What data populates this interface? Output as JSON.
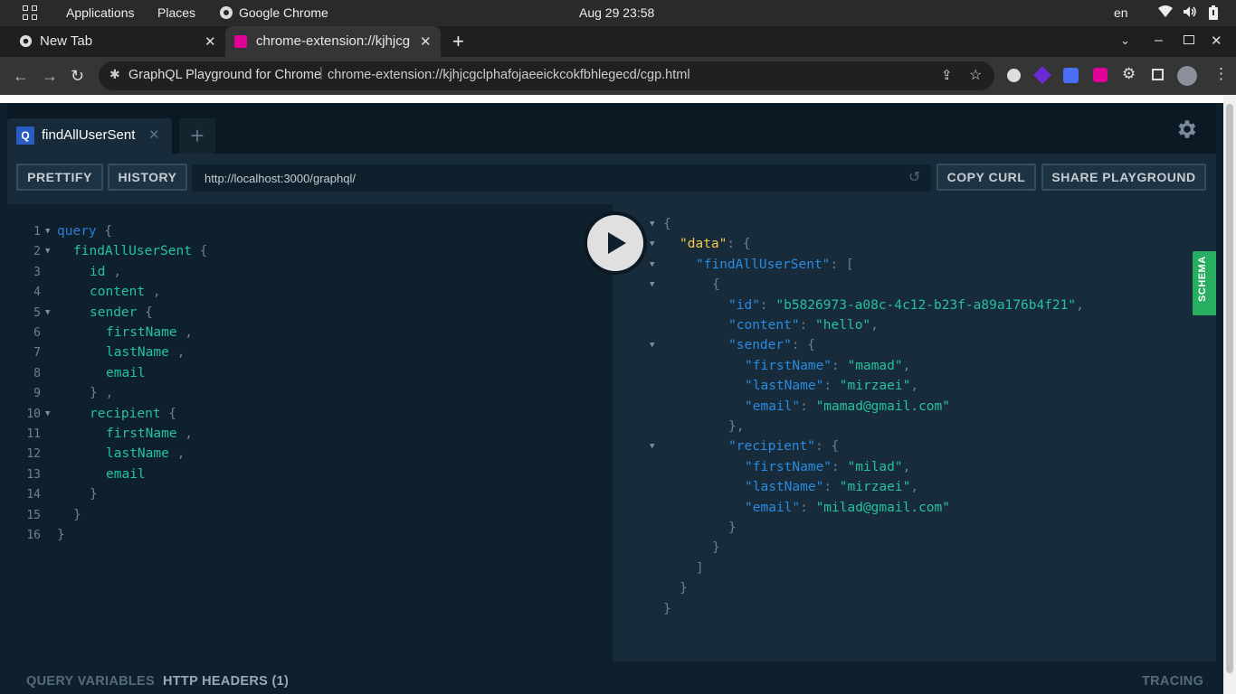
{
  "system": {
    "applications": "Applications",
    "places": "Places",
    "active_app": "Google Chrome",
    "clock": "Aug 29  23:58",
    "lang": "en"
  },
  "browser": {
    "tabs": [
      {
        "title": "New Tab"
      },
      {
        "title": "chrome-extension://kjhjcg"
      }
    ],
    "page_title": "GraphQL Playground for Chrome",
    "url": "chrome-extension://kjhjcgclphafojaeeickcokfbhlegecd/cgp.html"
  },
  "playground": {
    "tab": {
      "badge": "Q",
      "name": "findAllUserSent"
    },
    "buttons": {
      "prettify": "PRETTIFY",
      "history": "HISTORY",
      "copy_curl": "COPY CURL",
      "share": "SHARE PLAYGROUND"
    },
    "endpoint": "http://localhost:3000/graphql/",
    "schema_tab": "SCHEMA",
    "footer": {
      "query_variables": "QUERY VARIABLES",
      "http_headers": "HTTP HEADERS (1)",
      "tracing": "TRACING"
    },
    "query_lines": [
      {
        "n": "1",
        "indent": 0,
        "fold": true,
        "tokens": [
          {
            "t": "query",
            "c": "kw"
          },
          {
            "t": " {",
            "c": "punc"
          }
        ]
      },
      {
        "n": "2",
        "indent": 1,
        "fold": true,
        "tokens": [
          {
            "t": "findAllUserSent",
            "c": "field"
          },
          {
            "t": " {",
            "c": "punc"
          }
        ]
      },
      {
        "n": "3",
        "indent": 2,
        "fold": false,
        "tokens": [
          {
            "t": "id",
            "c": "field"
          },
          {
            "t": " ,",
            "c": "punc"
          }
        ]
      },
      {
        "n": "4",
        "indent": 2,
        "fold": false,
        "tokens": [
          {
            "t": "content",
            "c": "field"
          },
          {
            "t": " ,",
            "c": "punc"
          }
        ]
      },
      {
        "n": "5",
        "indent": 2,
        "fold": true,
        "tokens": [
          {
            "t": "sender",
            "c": "field"
          },
          {
            "t": " {",
            "c": "punc"
          }
        ]
      },
      {
        "n": "6",
        "indent": 3,
        "fold": false,
        "tokens": [
          {
            "t": "firstName",
            "c": "field"
          },
          {
            "t": " ,",
            "c": "punc"
          }
        ]
      },
      {
        "n": "7",
        "indent": 3,
        "fold": false,
        "tokens": [
          {
            "t": "lastName",
            "c": "field"
          },
          {
            "t": " ,",
            "c": "punc"
          }
        ]
      },
      {
        "n": "8",
        "indent": 3,
        "fold": false,
        "tokens": [
          {
            "t": "email",
            "c": "field"
          }
        ]
      },
      {
        "n": "9",
        "indent": 2,
        "fold": false,
        "tokens": [
          {
            "t": "} ,",
            "c": "punc"
          }
        ]
      },
      {
        "n": "10",
        "indent": 2,
        "fold": true,
        "tokens": [
          {
            "t": "recipient",
            "c": "field"
          },
          {
            "t": " {",
            "c": "punc"
          }
        ]
      },
      {
        "n": "11",
        "indent": 3,
        "fold": false,
        "tokens": [
          {
            "t": "firstName",
            "c": "field"
          },
          {
            "t": " ,",
            "c": "punc"
          }
        ]
      },
      {
        "n": "12",
        "indent": 3,
        "fold": false,
        "tokens": [
          {
            "t": "lastName",
            "c": "field"
          },
          {
            "t": " ,",
            "c": "punc"
          }
        ]
      },
      {
        "n": "13",
        "indent": 3,
        "fold": false,
        "tokens": [
          {
            "t": "email",
            "c": "field"
          }
        ]
      },
      {
        "n": "14",
        "indent": 2,
        "fold": false,
        "tokens": [
          {
            "t": "}",
            "c": "punc"
          }
        ]
      },
      {
        "n": "15",
        "indent": 1,
        "fold": false,
        "tokens": [
          {
            "t": "}",
            "c": "punc"
          }
        ]
      },
      {
        "n": "16",
        "indent": 0,
        "fold": false,
        "tokens": [
          {
            "t": "}",
            "c": "punc"
          }
        ]
      }
    ],
    "result_lines": [
      {
        "indent": 0,
        "fold": true,
        "tokens": [
          {
            "t": "{",
            "c": "punc"
          }
        ]
      },
      {
        "indent": 1,
        "fold": true,
        "tokens": [
          {
            "t": "\"data\"",
            "c": "datakey"
          },
          {
            "t": ": {",
            "c": "punc"
          }
        ]
      },
      {
        "indent": 2,
        "fold": true,
        "tokens": [
          {
            "t": "\"findAllUserSent\"",
            "c": "key"
          },
          {
            "t": ": [",
            "c": "punc"
          }
        ]
      },
      {
        "indent": 3,
        "fold": true,
        "tokens": [
          {
            "t": "{",
            "c": "punc"
          }
        ]
      },
      {
        "indent": 4,
        "fold": false,
        "tokens": [
          {
            "t": "\"id\"",
            "c": "key"
          },
          {
            "t": ": ",
            "c": "punc"
          },
          {
            "t": "\"b5826973-a08c-4c12-b23f-a89a176b4f21\"",
            "c": "str"
          },
          {
            "t": ",",
            "c": "punc"
          }
        ]
      },
      {
        "indent": 4,
        "fold": false,
        "tokens": [
          {
            "t": "\"content\"",
            "c": "key"
          },
          {
            "t": ": ",
            "c": "punc"
          },
          {
            "t": "\"hello\"",
            "c": "str"
          },
          {
            "t": ",",
            "c": "punc"
          }
        ]
      },
      {
        "indent": 4,
        "fold": true,
        "tokens": [
          {
            "t": "\"sender\"",
            "c": "key"
          },
          {
            "t": ": {",
            "c": "punc"
          }
        ]
      },
      {
        "indent": 5,
        "fold": false,
        "tokens": [
          {
            "t": "\"firstName\"",
            "c": "key"
          },
          {
            "t": ": ",
            "c": "punc"
          },
          {
            "t": "\"mamad\"",
            "c": "str"
          },
          {
            "t": ",",
            "c": "punc"
          }
        ]
      },
      {
        "indent": 5,
        "fold": false,
        "tokens": [
          {
            "t": "\"lastName\"",
            "c": "key"
          },
          {
            "t": ": ",
            "c": "punc"
          },
          {
            "t": "\"mirzaei\"",
            "c": "str"
          },
          {
            "t": ",",
            "c": "punc"
          }
        ]
      },
      {
        "indent": 5,
        "fold": false,
        "tokens": [
          {
            "t": "\"email\"",
            "c": "key"
          },
          {
            "t": ": ",
            "c": "punc"
          },
          {
            "t": "\"mamad@gmail.com\"",
            "c": "str"
          }
        ]
      },
      {
        "indent": 4,
        "fold": false,
        "tokens": [
          {
            "t": "},",
            "c": "punc"
          }
        ]
      },
      {
        "indent": 4,
        "fold": true,
        "tokens": [
          {
            "t": "\"recipient\"",
            "c": "key"
          },
          {
            "t": ": {",
            "c": "punc"
          }
        ]
      },
      {
        "indent": 5,
        "fold": false,
        "tokens": [
          {
            "t": "\"firstName\"",
            "c": "key"
          },
          {
            "t": ": ",
            "c": "punc"
          },
          {
            "t": "\"milad\"",
            "c": "str"
          },
          {
            "t": ",",
            "c": "punc"
          }
        ]
      },
      {
        "indent": 5,
        "fold": false,
        "tokens": [
          {
            "t": "\"lastName\"",
            "c": "key"
          },
          {
            "t": ": ",
            "c": "punc"
          },
          {
            "t": "\"mirzaei\"",
            "c": "str"
          },
          {
            "t": ",",
            "c": "punc"
          }
        ]
      },
      {
        "indent": 5,
        "fold": false,
        "tokens": [
          {
            "t": "\"email\"",
            "c": "key"
          },
          {
            "t": ": ",
            "c": "punc"
          },
          {
            "t": "\"milad@gmail.com\"",
            "c": "str"
          }
        ]
      },
      {
        "indent": 4,
        "fold": false,
        "tokens": [
          {
            "t": "}",
            "c": "punc"
          }
        ]
      },
      {
        "indent": 3,
        "fold": false,
        "tokens": [
          {
            "t": "}",
            "c": "punc"
          }
        ]
      },
      {
        "indent": 2,
        "fold": false,
        "tokens": [
          {
            "t": "]",
            "c": "punc"
          }
        ]
      },
      {
        "indent": 1,
        "fold": false,
        "tokens": [
          {
            "t": "}",
            "c": "punc"
          }
        ]
      },
      {
        "indent": 0,
        "fold": false,
        "tokens": [
          {
            "t": "}",
            "c": "punc"
          }
        ]
      }
    ]
  }
}
